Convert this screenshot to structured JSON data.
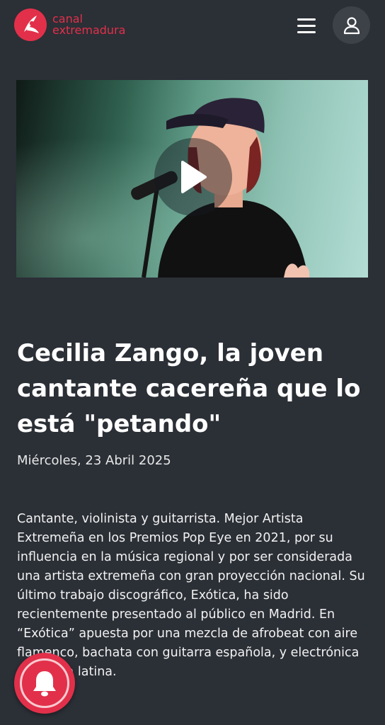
{
  "header": {
    "logo": {
      "line1": "canal",
      "line2": "extremadura"
    },
    "menu_icon": "hamburger-menu-icon",
    "user_icon": "user-icon"
  },
  "video": {
    "play_icon": "play-icon"
  },
  "article": {
    "title": "Cecilia Zango, la joven cantante cacereña que lo está \"petando\"",
    "date": "Miércoles, 23 Abril 2025",
    "body": "Cantante, violinista y guitarrista. Mejor Artista Extremeña en los Premios Pop Eye en 2021, por su influencia en la música regional y por ser considerada una artista extremeña con gran proyección nacional. Su último trabajo discográfico, Exótica, ha sido recientemente presentado al público en Madrid. En “Exótica” apuesta por una mezcla de afrobeat con aire flamenco, bachata con guitarra española, y electrónica con alma latina."
  },
  "notification": {
    "icon": "bell-icon"
  },
  "colors": {
    "background": "#2b2f36",
    "accent": "#e2304a",
    "text": "#ffffff"
  }
}
